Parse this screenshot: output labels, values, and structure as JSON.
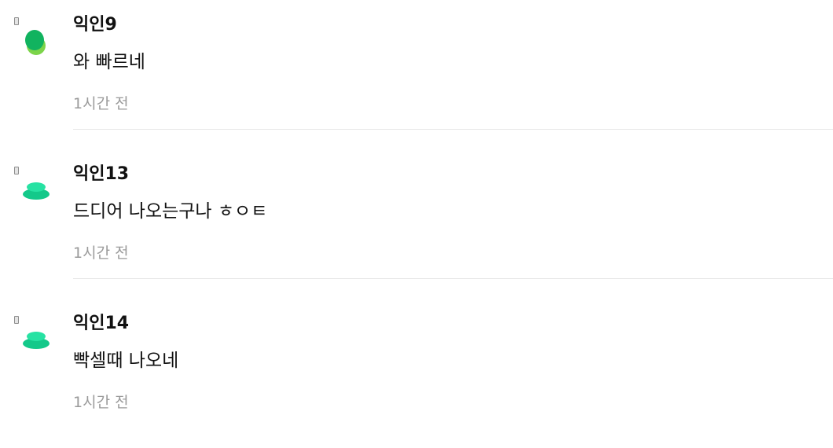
{
  "colors": {
    "avatar_green": "#11b35f",
    "avatar_lime": "#7cd44a",
    "avatar_teal": "#14c98a",
    "avatar_mint": "#27e2a3",
    "time_text": "#9a9a9a"
  },
  "comments": [
    {
      "author": "익인9",
      "text": "와 빠르네",
      "time": "1시간 전",
      "avatar_icon": "green-leaf-avatar-icon"
    },
    {
      "author": "익인13",
      "text": "드디어 나오는구나 ㅎㅇㅌ",
      "time": "1시간 전",
      "avatar_icon": "teal-disc-avatar-icon"
    },
    {
      "author": "익인14",
      "text": "빡셀때 나오네",
      "time": "1시간 전",
      "avatar_icon": "teal-disc-avatar-icon"
    }
  ]
}
